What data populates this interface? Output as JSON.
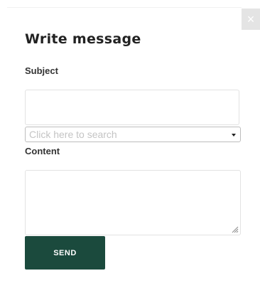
{
  "dialog": {
    "title": "Write message",
    "close_glyph": "×"
  },
  "form": {
    "subject_label": "Subject",
    "subject_value": "",
    "recipient_select": {
      "placeholder": "Click here to search",
      "icon": "chevron-down-icon"
    },
    "content_label": "Content",
    "content_value": "",
    "send_label": "SEND"
  },
  "colors": {
    "send_button_bg": "#1b4a3d",
    "close_button_bg": "#e4e4e4",
    "placeholder_text": "#c4c4c4"
  }
}
